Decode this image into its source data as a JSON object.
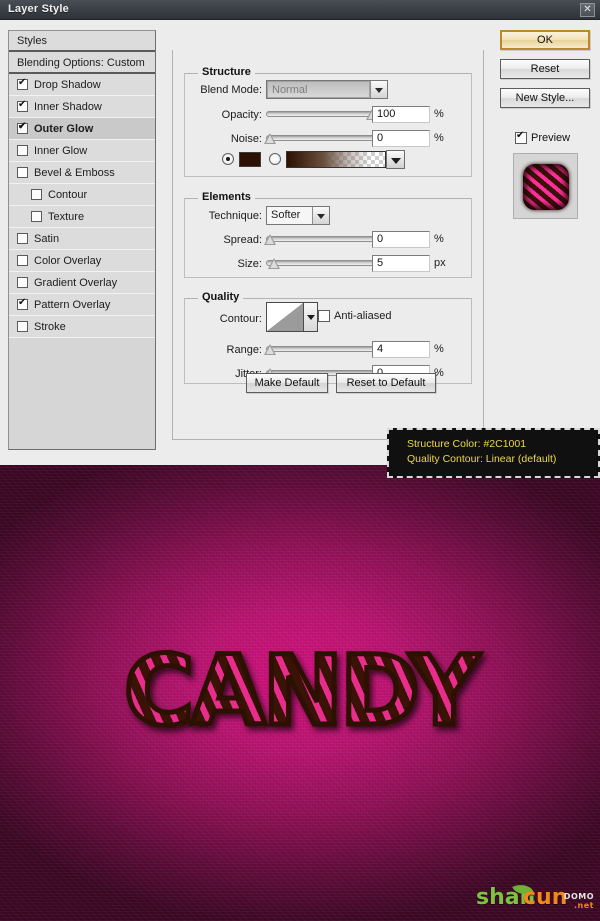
{
  "window": {
    "title": "Layer Style",
    "close_label": "✕"
  },
  "styles_panel": {
    "header": "Styles",
    "blending_options": "Blending Options: Custom",
    "items": [
      {
        "label": "Drop Shadow",
        "checked": true,
        "indent": false,
        "selected": false
      },
      {
        "label": "Inner Shadow",
        "checked": true,
        "indent": false,
        "selected": false
      },
      {
        "label": "Outer Glow",
        "checked": true,
        "indent": false,
        "selected": true
      },
      {
        "label": "Inner Glow",
        "checked": false,
        "indent": false,
        "selected": false
      },
      {
        "label": "Bevel & Emboss",
        "checked": false,
        "indent": false,
        "selected": false
      },
      {
        "label": "Contour",
        "checked": false,
        "indent": true,
        "selected": false
      },
      {
        "label": "Texture",
        "checked": false,
        "indent": true,
        "selected": false
      },
      {
        "label": "Satin",
        "checked": false,
        "indent": false,
        "selected": false
      },
      {
        "label": "Color Overlay",
        "checked": false,
        "indent": false,
        "selected": false
      },
      {
        "label": "Gradient Overlay",
        "checked": false,
        "indent": false,
        "selected": false
      },
      {
        "label": "Pattern Overlay",
        "checked": true,
        "indent": false,
        "selected": false
      },
      {
        "label": "Stroke",
        "checked": false,
        "indent": false,
        "selected": false
      }
    ]
  },
  "panel": {
    "group_title": "Outer Glow",
    "structure": {
      "title": "Structure",
      "blend_mode_label": "Blend Mode:",
      "blend_mode_value": "Normal",
      "opacity_label": "Opacity:",
      "opacity_value": "100",
      "opacity_unit": "%",
      "noise_label": "Noise:",
      "noise_value": "0",
      "noise_unit": "%",
      "color_swatch": "#2C1001",
      "fill_type": "color"
    },
    "elements": {
      "title": "Elements",
      "technique_label": "Technique:",
      "technique_value": "Softer",
      "spread_label": "Spread:",
      "spread_value": "0",
      "spread_unit": "%",
      "size_label": "Size:",
      "size_value": "5",
      "size_unit": "px"
    },
    "quality": {
      "title": "Quality",
      "contour_label": "Contour:",
      "contour_value": "Linear",
      "anti_aliased_label": "Anti-aliased",
      "anti_aliased_checked": false,
      "range_label": "Range:",
      "range_value": "4",
      "range_unit": "%",
      "jitter_label": "Jitter:",
      "jitter_value": "0",
      "jitter_unit": "%"
    },
    "make_default": "Make Default",
    "reset_to_default": "Reset to Default"
  },
  "actions": {
    "ok": "OK",
    "reset": "Reset",
    "new_style": "New Style...",
    "preview_label": "Preview",
    "preview_checked": true
  },
  "callout": {
    "line1": "Structure Color: #2C1001",
    "line2": "Quality Contour: Linear (default)",
    "text_color": "#EAD84A",
    "background": "#111010"
  },
  "photo": {
    "word": "CANDY",
    "background_color": "#B8146F",
    "stripe_dark": "#2C1001",
    "stripe_pink": "#E82D8C"
  },
  "watermark": {
    "part1": "shan",
    "part2": "cun",
    "domain_top": "DOMO",
    "domain_bottom": ".net"
  }
}
